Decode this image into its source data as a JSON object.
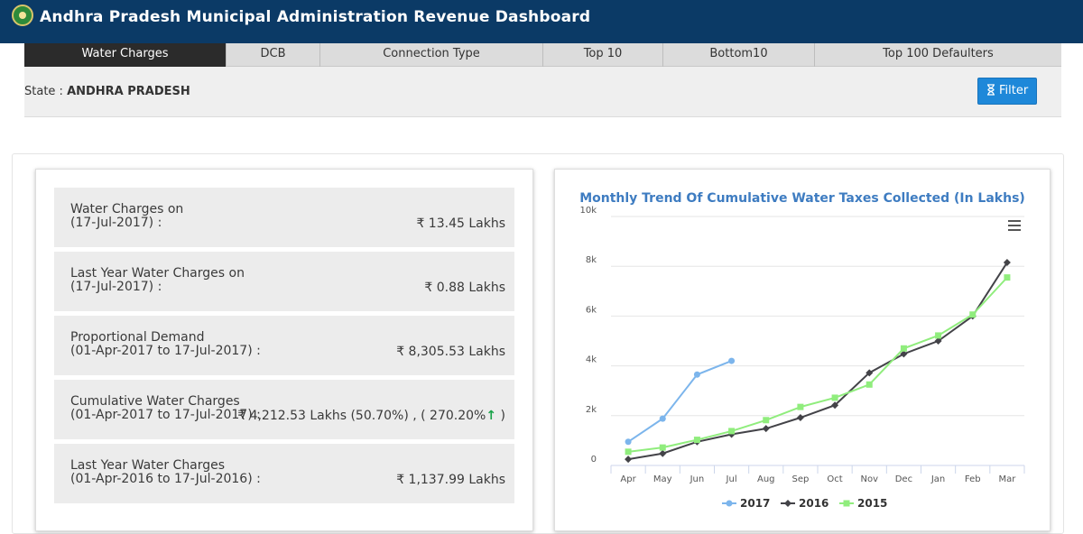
{
  "app": {
    "title": "Andhra Pradesh Municipal Administration Revenue Dashboard"
  },
  "tabs": [
    {
      "label": "Water Charges",
      "active": true
    },
    {
      "label": "DCB",
      "active": false
    },
    {
      "label": "Connection Type",
      "active": false
    },
    {
      "label": "Top 10",
      "active": false
    },
    {
      "label": "Bottom10",
      "active": false
    },
    {
      "label": "Top 100 Defaulters",
      "active": false
    }
  ],
  "filter": {
    "state_label": "State : ",
    "state_value": "ANDHRA PRADESH",
    "button_label": "Filter",
    "button_icon": "hourglass-icon"
  },
  "stats": [
    {
      "label": "Water Charges on\n(17-Jul-2017) :",
      "value": "₹ 13.45 Lakhs"
    },
    {
      "label": "Last Year Water Charges on\n(17-Jul-2017) :",
      "value": "₹ 0.88 Lakhs"
    },
    {
      "label": "Proportional Demand\n(01-Apr-2017 to 17-Jul-2017) :",
      "value": "₹ 8,305.53 Lakhs"
    },
    {
      "label": "Cumulative Water Charges\n(01-Apr-2017 to 17-Jul-2017) :",
      "value": "₹ 4,212.53 Lakhs (50.70%) , ( 270.20%",
      "trend_icon": "↑",
      "value_suffix": " )"
    },
    {
      "label": "Last Year Water Charges\n(01-Apr-2016 to 17-Jul-2016) :",
      "value": "₹ 1,137.99 Lakhs"
    }
  ],
  "colors": {
    "header": "#0b3a66",
    "accent": "#1e88d9",
    "s2017": "#7cb5ec",
    "s2016": "#434348",
    "s2015": "#90ed7d"
  },
  "chart_data": {
    "type": "line",
    "title": "Monthly Trend Of Cumulative Water Taxes Collected (In Lakhs)",
    "categories": [
      "Apr",
      "May",
      "Jun",
      "Jul",
      "Aug",
      "Sep",
      "Oct",
      "Nov",
      "Dec",
      "Jan",
      "Feb",
      "Mar"
    ],
    "y_ticks": [
      "0",
      "2k",
      "4k",
      "6k",
      "8k",
      "10k"
    ],
    "ylim": [
      0,
      10000
    ],
    "grid": true,
    "legend": "bottom",
    "series": [
      {
        "name": "2017",
        "color": "#7cb5ec",
        "marker": "circle",
        "values": [
          950,
          1880,
          3650,
          4200,
          null,
          null,
          null,
          null,
          null,
          null,
          null,
          null
        ]
      },
      {
        "name": "2016",
        "color": "#434348",
        "marker": "diamond",
        "values": [
          250,
          480,
          950,
          1250,
          1480,
          1920,
          2420,
          3720,
          4480,
          5000,
          6000,
          8150
        ]
      },
      {
        "name": "2015",
        "color": "#90ed7d",
        "marker": "square",
        "values": [
          550,
          720,
          1030,
          1380,
          1820,
          2350,
          2720,
          3250,
          4700,
          5220,
          6060,
          7550
        ]
      }
    ]
  }
}
